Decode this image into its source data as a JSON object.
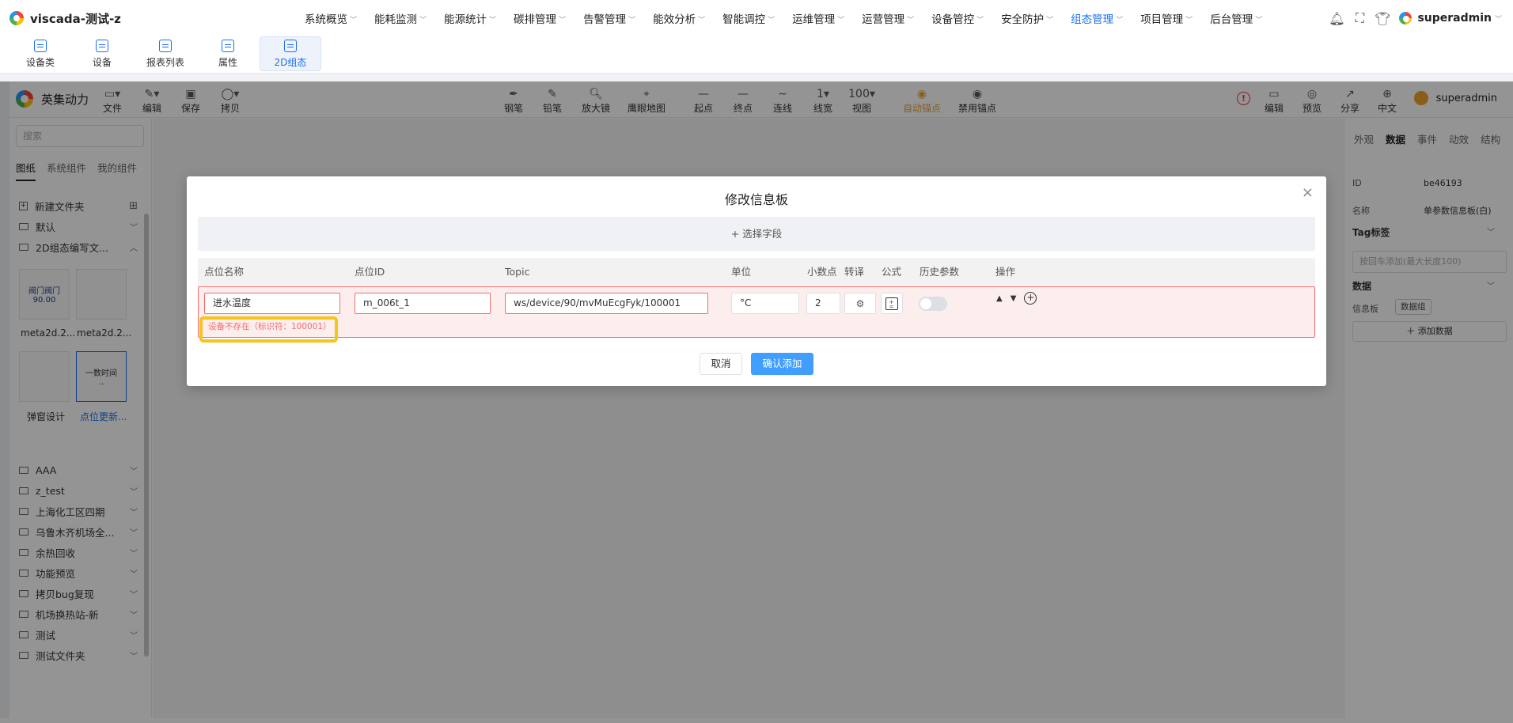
{
  "app": {
    "title": "viscada-测试-z",
    "user": "superadmin"
  },
  "menu": [
    {
      "label": "系统概览",
      "active": false
    },
    {
      "label": "能耗监测",
      "active": false
    },
    {
      "label": "能源统计",
      "active": false
    },
    {
      "label": "碳排管理",
      "active": false
    },
    {
      "label": "告警管理",
      "active": false
    },
    {
      "label": "能效分析",
      "active": false
    },
    {
      "label": "智能调控",
      "active": false
    },
    {
      "label": "运维管理",
      "active": false
    },
    {
      "label": "运营管理",
      "active": false
    },
    {
      "label": "设备管控",
      "active": false
    },
    {
      "label": "安全防护",
      "active": false
    },
    {
      "label": "组态管理",
      "active": true
    },
    {
      "label": "项目管理",
      "active": false
    },
    {
      "label": "后台管理",
      "active": false
    }
  ],
  "subtabs": [
    "设备类",
    "设备",
    "报表列表",
    "属性",
    "2D组态"
  ],
  "editor": {
    "brand": "英集动力",
    "user": "superadmin",
    "tools": [
      {
        "label": "文件",
        "glyph": "▭▾"
      },
      {
        "label": "编辑",
        "glyph": "✎▾"
      },
      {
        "label": "保存",
        "glyph": "▣"
      },
      {
        "label": "拷贝",
        "glyph": "◯▾"
      },
      {
        "label": "钢笔",
        "glyph": "✒"
      },
      {
        "label": "铅笔",
        "glyph": "✎"
      },
      {
        "label": "放大镜",
        "glyph": "🔍︎"
      },
      {
        "label": "鹰眼地图",
        "glyph": "⌖"
      },
      {
        "label": "起点",
        "glyph": "—"
      },
      {
        "label": "终点",
        "glyph": "—"
      },
      {
        "label": "连线",
        "glyph": "∼"
      },
      {
        "label": "线宽",
        "glyph": "1▾"
      },
      {
        "label": "视图",
        "glyph": "100▾"
      },
      {
        "label": "自动锚点",
        "glyph": "◉"
      },
      {
        "label": "禁用锚点",
        "glyph": "◉"
      },
      {
        "label": "编辑",
        "glyph": "▭"
      },
      {
        "label": "预览",
        "glyph": "◎"
      },
      {
        "label": "分享",
        "glyph": "↗"
      },
      {
        "label": "中文",
        "glyph": "⊕"
      }
    ]
  },
  "left_panel": {
    "search_placeholder": "搜索",
    "tabs": [
      "图纸",
      "系统组件",
      "我的组件"
    ],
    "new_folder": "新建文件夹",
    "folders_top": [
      "默认",
      "2D组态编写文..."
    ],
    "thumbs": [
      {
        "label": "meta2d.2...",
        "content": "阀门阀门\n90.00"
      },
      {
        "label": "meta2d.2...",
        "content": ""
      },
      {
        "label": "弹窗设计",
        "content": ""
      },
      {
        "label": "点位更新...",
        "content": "一数时间\n.."
      }
    ],
    "folders": [
      "AAA",
      "z_test",
      "上海化工区四期",
      "乌鲁木齐机场全...",
      "余热回收",
      "功能预览",
      "拷贝bug复现",
      "机场换热站-新",
      "测试",
      "测试文件夹"
    ]
  },
  "right_panel": {
    "tabs": [
      "外观",
      "数据",
      "事件",
      "动效",
      "结构"
    ],
    "id_label": "ID",
    "id_value": "be46193",
    "name_label": "名称",
    "name_value": "单参数信息板(白)",
    "tag_section": "Tag标签",
    "tag_placeholder": "按回车添加(最大长度100)",
    "data_section": "数据",
    "info_label": "信息板",
    "data_group": "数据组",
    "add_data": "＋ 添加数据"
  },
  "dialog": {
    "title": "修改信息板",
    "add_field": "+ 选择字段",
    "columns": [
      "点位名称",
      "点位ID",
      "Topic",
      "单位",
      "小数点",
      "转译",
      "公式",
      "历史参数",
      "操作"
    ],
    "row": {
      "name": "进水温度",
      "point_id": "m_006t_1",
      "topic": "ws/device/90/mvMuEcgFyk/100001",
      "unit": "°C",
      "decimals": "2",
      "history_enabled": false
    },
    "error": "设备不存在（标识符：100001）",
    "cancel": "取消",
    "confirm": "确认添加"
  },
  "colors": {
    "accent": "#1a6ef5",
    "primary_button": "#409eff",
    "error": "#f56c6c",
    "highlight": "#f5c518"
  }
}
